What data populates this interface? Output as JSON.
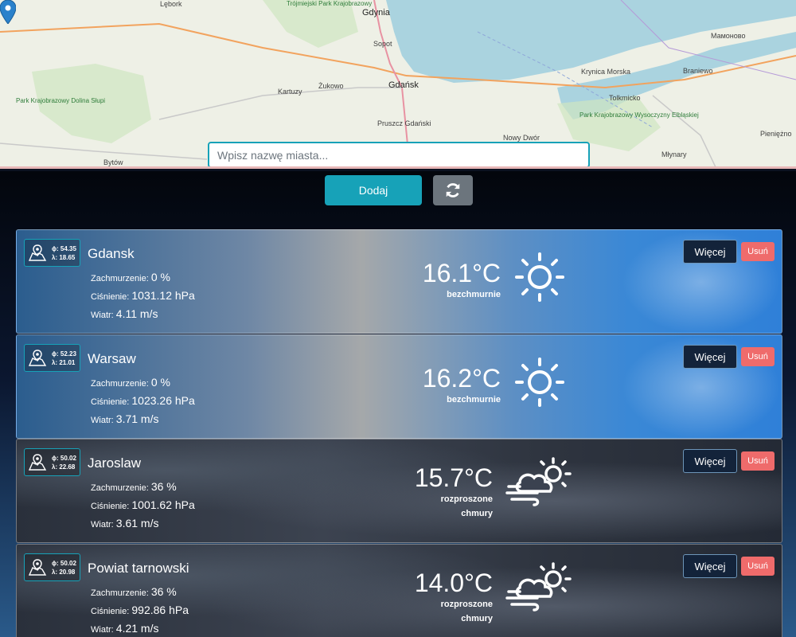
{
  "map": {
    "labels": [
      "Lębork",
      "Trójmiejski Park Krajobrazowy",
      "Gdynia",
      "Sopot",
      "Gdańsk",
      "Żukowo",
      "Kartuzy",
      "Park Krajobrazowy Dolina Słupi",
      "Pruszcz Gdański",
      "Krynica Morska",
      "Tolkmicko",
      "Park Krajobrazowy Wysoczyzny Elbląskiej",
      "Braniewo",
      "Мамоново",
      "Pieniężno",
      "Młynary",
      "Nowy Dwór",
      "Bytów"
    ]
  },
  "search": {
    "placeholder": "Wpisz nazwę miasta..."
  },
  "buttons": {
    "add": "Dodaj",
    "refresh_icon": "refresh-icon",
    "more": "Więcej",
    "delete": "Usuń"
  },
  "labels": {
    "cloudiness": "Zachmurzenie:",
    "pressure": "Ciśnienie:",
    "wind": "Wiatr:",
    "lat_symbol": "ϕ:",
    "lon_symbol": "λ:"
  },
  "cities": [
    {
      "name": "Gdansk",
      "lat": "54.35",
      "lon": "18.65",
      "cloudiness": "0 %",
      "pressure": "1031.12 hPa",
      "wind": "4.11 m/s",
      "temp": "16.1°C",
      "desc": "bezchmurnie",
      "icon": "sun-icon"
    },
    {
      "name": "Warsaw",
      "lat": "52.23",
      "lon": "21.01",
      "cloudiness": "0 %",
      "pressure": "1023.26 hPa",
      "wind": "3.71 m/s",
      "temp": "16.2°C",
      "desc": "bezchmurnie",
      "icon": "sun-icon"
    },
    {
      "name": "Jaroslaw",
      "lat": "50.02",
      "lon": "22.68",
      "cloudiness": "36 %",
      "pressure": "1001.62 hPa",
      "wind": "3.61 m/s",
      "temp": "15.7°C",
      "desc": "rozproszone chmury",
      "icon": "partly-cloudy-wind-icon"
    },
    {
      "name": "Powiat tarnowski",
      "lat": "50.02",
      "lon": "20.98",
      "cloudiness": "36 %",
      "pressure": "992.86 hPa",
      "wind": "4.21 m/s",
      "temp": "14.0°C",
      "desc": "rozproszone chmury",
      "icon": "partly-cloudy-wind-icon"
    }
  ],
  "colors": {
    "accent": "#17a2b8",
    "secondary": "#6c757d",
    "danger": "#ef6b6b",
    "more_bg": "#13233a"
  }
}
